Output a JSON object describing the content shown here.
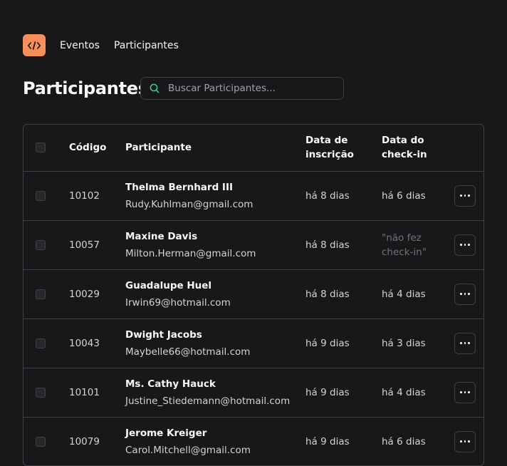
{
  "nav": {
    "links": [
      "Eventos",
      "Participantes"
    ]
  },
  "page": {
    "title": "Participantes"
  },
  "search": {
    "placeholder": "Buscar Participantes...",
    "value": ""
  },
  "table": {
    "headers": {
      "code": "Código",
      "participant": "Participante",
      "registered": "Data de inscrição",
      "checkin": "Data do check-in"
    },
    "rows": [
      {
        "code": "10102",
        "name": "Thelma Bernhard III",
        "email": "Rudy.Kuhlman@gmail.com",
        "registered": "há 8 dias",
        "checkin": "há 6 dias",
        "no_checkin": false
      },
      {
        "code": "10057",
        "name": "Maxine Davis",
        "email": "Milton.Herman@gmail.com",
        "registered": "há 8 dias",
        "checkin": "\"não fez check-in\"",
        "no_checkin": true
      },
      {
        "code": "10029",
        "name": "Guadalupe Huel",
        "email": "Irwin69@hotmail.com",
        "registered": "há 8 dias",
        "checkin": "há 4 dias",
        "no_checkin": false
      },
      {
        "code": "10043",
        "name": "Dwight Jacobs",
        "email": "Maybelle66@hotmail.com",
        "registered": "há 9 dias",
        "checkin": "há 3 dias",
        "no_checkin": false
      },
      {
        "code": "10101",
        "name": "Ms. Cathy Hauck",
        "email": "Justine_Stiedemann@hotmail.com",
        "registered": "há 9 dias",
        "checkin": "há 4 dias",
        "no_checkin": false
      },
      {
        "code": "10079",
        "name": "Jerome Kreiger",
        "email": "Carol.Mitchell@gmail.com",
        "registered": "há 9 dias",
        "checkin": "há 6 dias",
        "no_checkin": false
      }
    ]
  },
  "icons": {
    "logo": "code-icon",
    "search": "search-icon",
    "row_action": "more-horizontal-icon"
  },
  "colors": {
    "background": "#18181b",
    "accent": "#f5905b",
    "border": "#3f3f46",
    "search_icon": "#34d399",
    "muted_text": "#71717a"
  }
}
